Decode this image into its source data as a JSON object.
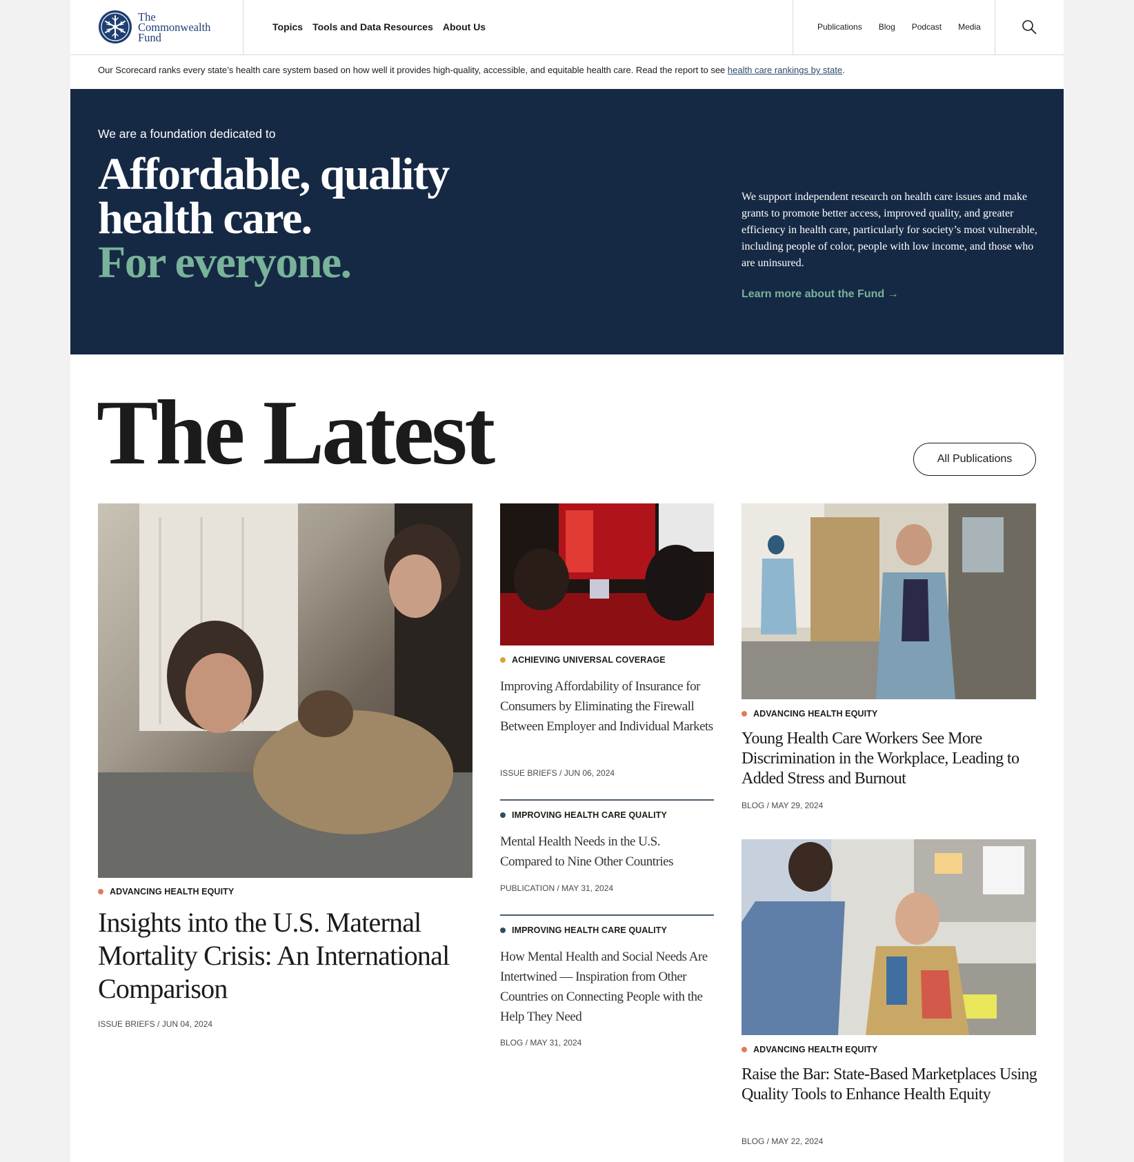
{
  "logo": {
    "line1": "The",
    "line2": "Commonwealth",
    "line3": "Fund"
  },
  "nav_main": [
    "Topics",
    "Tools and Data Resources",
    "About Us"
  ],
  "nav_secondary": [
    "Publications",
    "Blog",
    "Podcast",
    "Media"
  ],
  "search": {
    "icon": "search-icon"
  },
  "notice": {
    "text": "Our Scorecard ranks every state’s health care system based on how well it provides high-quality, accessible, and equitable health care. Read the report to see ",
    "link": "health care rankings by state",
    "end": "."
  },
  "hero": {
    "intro": "We are a foundation dedicated to",
    "line1": "Affordable, quality",
    "line2": "health care.",
    "line3": "For everyone.",
    "description": "We support independent research on health care issues and make grants to promote better access, improved quality, and greater efficiency in health care, particularly for society’s most vulnerable, including people of color, people with low income, and those who are uninsured.",
    "link": "Learn more about the Fund →"
  },
  "latest": {
    "title": "The Latest",
    "all_button": "All Publications",
    "articles": [
      {
        "tag": "ADVANCING HEALTH EQUITY",
        "title": "Insights into the U.S. Maternal Mortality Crisis: An International Comparison",
        "meta": "ISSUE BRIEFS / JUN 04, 2024"
      },
      {
        "tag": "ACHIEVING UNIVERSAL COVERAGE",
        "title": "Improving Affordability of Insurance for Consumers by Eliminating the Firewall Between Employer and Individual Markets",
        "meta": "ISSUE BRIEFS / JUN 06, 2024"
      },
      {
        "tag": "IMPROVING HEALTH CARE QUALITY",
        "title": "Mental Health Needs in the U.S. Compared to Nine Other Countries",
        "meta": "PUBLICATION / MAY 31, 2024"
      },
      {
        "tag": "IMPROVING HEALTH CARE QUALITY",
        "title": "How Mental Health and Social Needs Are Intertwined — Inspiration from Other Countries on Connecting People with the Help They Need",
        "meta": "BLOG / MAY 31, 2024"
      },
      {
        "tag": "ADVANCING HEALTH EQUITY",
        "title": "Young Health Care Workers See More Discrimination in the Workplace, Leading to Added Stress and Burnout",
        "meta": "BLOG / MAY 29, 2024"
      },
      {
        "tag": "ADVANCING HEALTH EQUITY",
        "title": "Raise the Bar: State-Based Marketplaces Using Quality Tools to Enhance Health Equity",
        "meta": "BLOG / MAY 22, 2024"
      }
    ]
  },
  "colors": {
    "navy": "#162944",
    "green": "#78b39a",
    "equity": "#e07b5a",
    "coverage": "#d4a534",
    "quality": "#2f4f5f"
  }
}
